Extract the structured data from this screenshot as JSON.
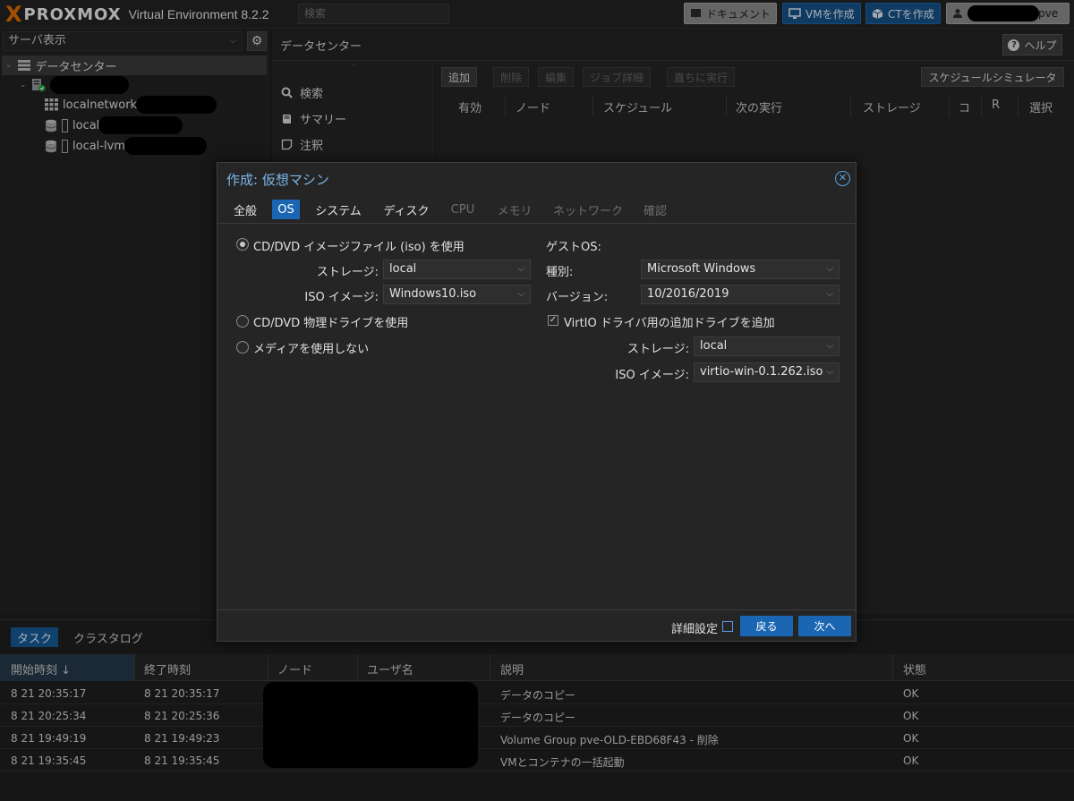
{
  "app": {
    "logo_x": "X",
    "logo_name": "PROXMOX",
    "version": "Virtual Environment 8.2.2",
    "search_placeholder": "検索"
  },
  "topbar": {
    "docs_label": "ドキュメント",
    "create_vm_label": "VMを作成",
    "create_ct_label": "CTを作成",
    "user_suffix": "pve"
  },
  "tree": {
    "view_label": "サーバ表示",
    "datacenter": "データセンター",
    "items": [
      {
        "label": "localnetwork",
        "icon": "network-grid-icon"
      },
      {
        "label": "local",
        "icon": "storage-icon"
      },
      {
        "label": "local-lvm",
        "icon": "storage-icon"
      }
    ]
  },
  "datacenter": {
    "title": "データセンター",
    "help_label": "ヘルプ",
    "nav": [
      {
        "label": "検索",
        "icon": "search-icon"
      },
      {
        "label": "サマリー",
        "icon": "book-icon"
      },
      {
        "label": "注釈",
        "icon": "note-icon"
      }
    ]
  },
  "toolbar": {
    "add": "追加",
    "remove": "削除",
    "edit": "編集",
    "job_detail": "ジョブ詳細",
    "run_now": "直ちに実行",
    "schedule_sim": "スケジュールシミュレータ"
  },
  "job_columns": [
    "有効",
    "ノード",
    "スケジュール",
    "次の実行",
    "ストレージ",
    "コ",
    "R",
    "選択"
  ],
  "dialog": {
    "title": "作成: 仮想マシン",
    "tabs": [
      {
        "label": "全般",
        "state": "normal"
      },
      {
        "label": "OS",
        "state": "active"
      },
      {
        "label": "システム",
        "state": "normal"
      },
      {
        "label": "ディスク",
        "state": "normal"
      },
      {
        "label": "CPU",
        "state": "disabled"
      },
      {
        "label": "メモリ",
        "state": "disabled"
      },
      {
        "label": "ネットワーク",
        "state": "disabled"
      },
      {
        "label": "確認",
        "state": "disabled"
      }
    ],
    "media": {
      "use_iso": "CD/DVD イメージファイル (iso) を使用",
      "storage_label": "ストレージ:",
      "storage_value": "local",
      "iso_label": "ISO イメージ:",
      "iso_value": "Windows10.iso",
      "use_physical": "CD/DVD 物理ドライブを使用",
      "no_media": "メディアを使用しない"
    },
    "guest": {
      "heading": "ゲストOS:",
      "type_label": "種別:",
      "type_value": "Microsoft Windows",
      "version_label": "バージョン:",
      "version_value": "10/2016/2019",
      "virtio_label": "VirtIO ドライバ用の追加ドライブを追加",
      "virtio_checked": true,
      "storage_label": "ストレージ:",
      "storage_value": "local",
      "iso_label": "ISO イメージ:",
      "iso_value": "virtio-win-0.1.262.iso"
    },
    "footer": {
      "advanced_label": "詳細設定",
      "back_label": "戻る",
      "next_label": "次へ"
    }
  },
  "tasks": {
    "tab_tasks": "タスク",
    "tab_cluster": "クラスタログ",
    "columns": [
      "開始時刻 ↓",
      "終了時刻",
      "ノード",
      "ユーザ名",
      "説明",
      "状態"
    ],
    "rows": [
      {
        "start": "8 21 20:35:17",
        "end": "8 21 20:35:17",
        "desc": "データのコピー",
        "status": "OK"
      },
      {
        "start": "8 21 20:25:34",
        "end": "8 21 20:25:36",
        "desc": "データのコピー",
        "status": "OK"
      },
      {
        "start": "8 21 19:49:19",
        "end": "8 21 19:49:23",
        "desc": "Volume Group pve-OLD-EBD68F43 - 削除",
        "status": "OK"
      },
      {
        "start": "8 21 19:35:45",
        "end": "8 21 19:35:45",
        "desc": "VMとコンテナの一括起動",
        "status": "OK"
      }
    ]
  },
  "colors": {
    "accent_blue": "#1b66b3",
    "title_blue": "#7ab6ea",
    "logo_orange": "#e57000"
  }
}
